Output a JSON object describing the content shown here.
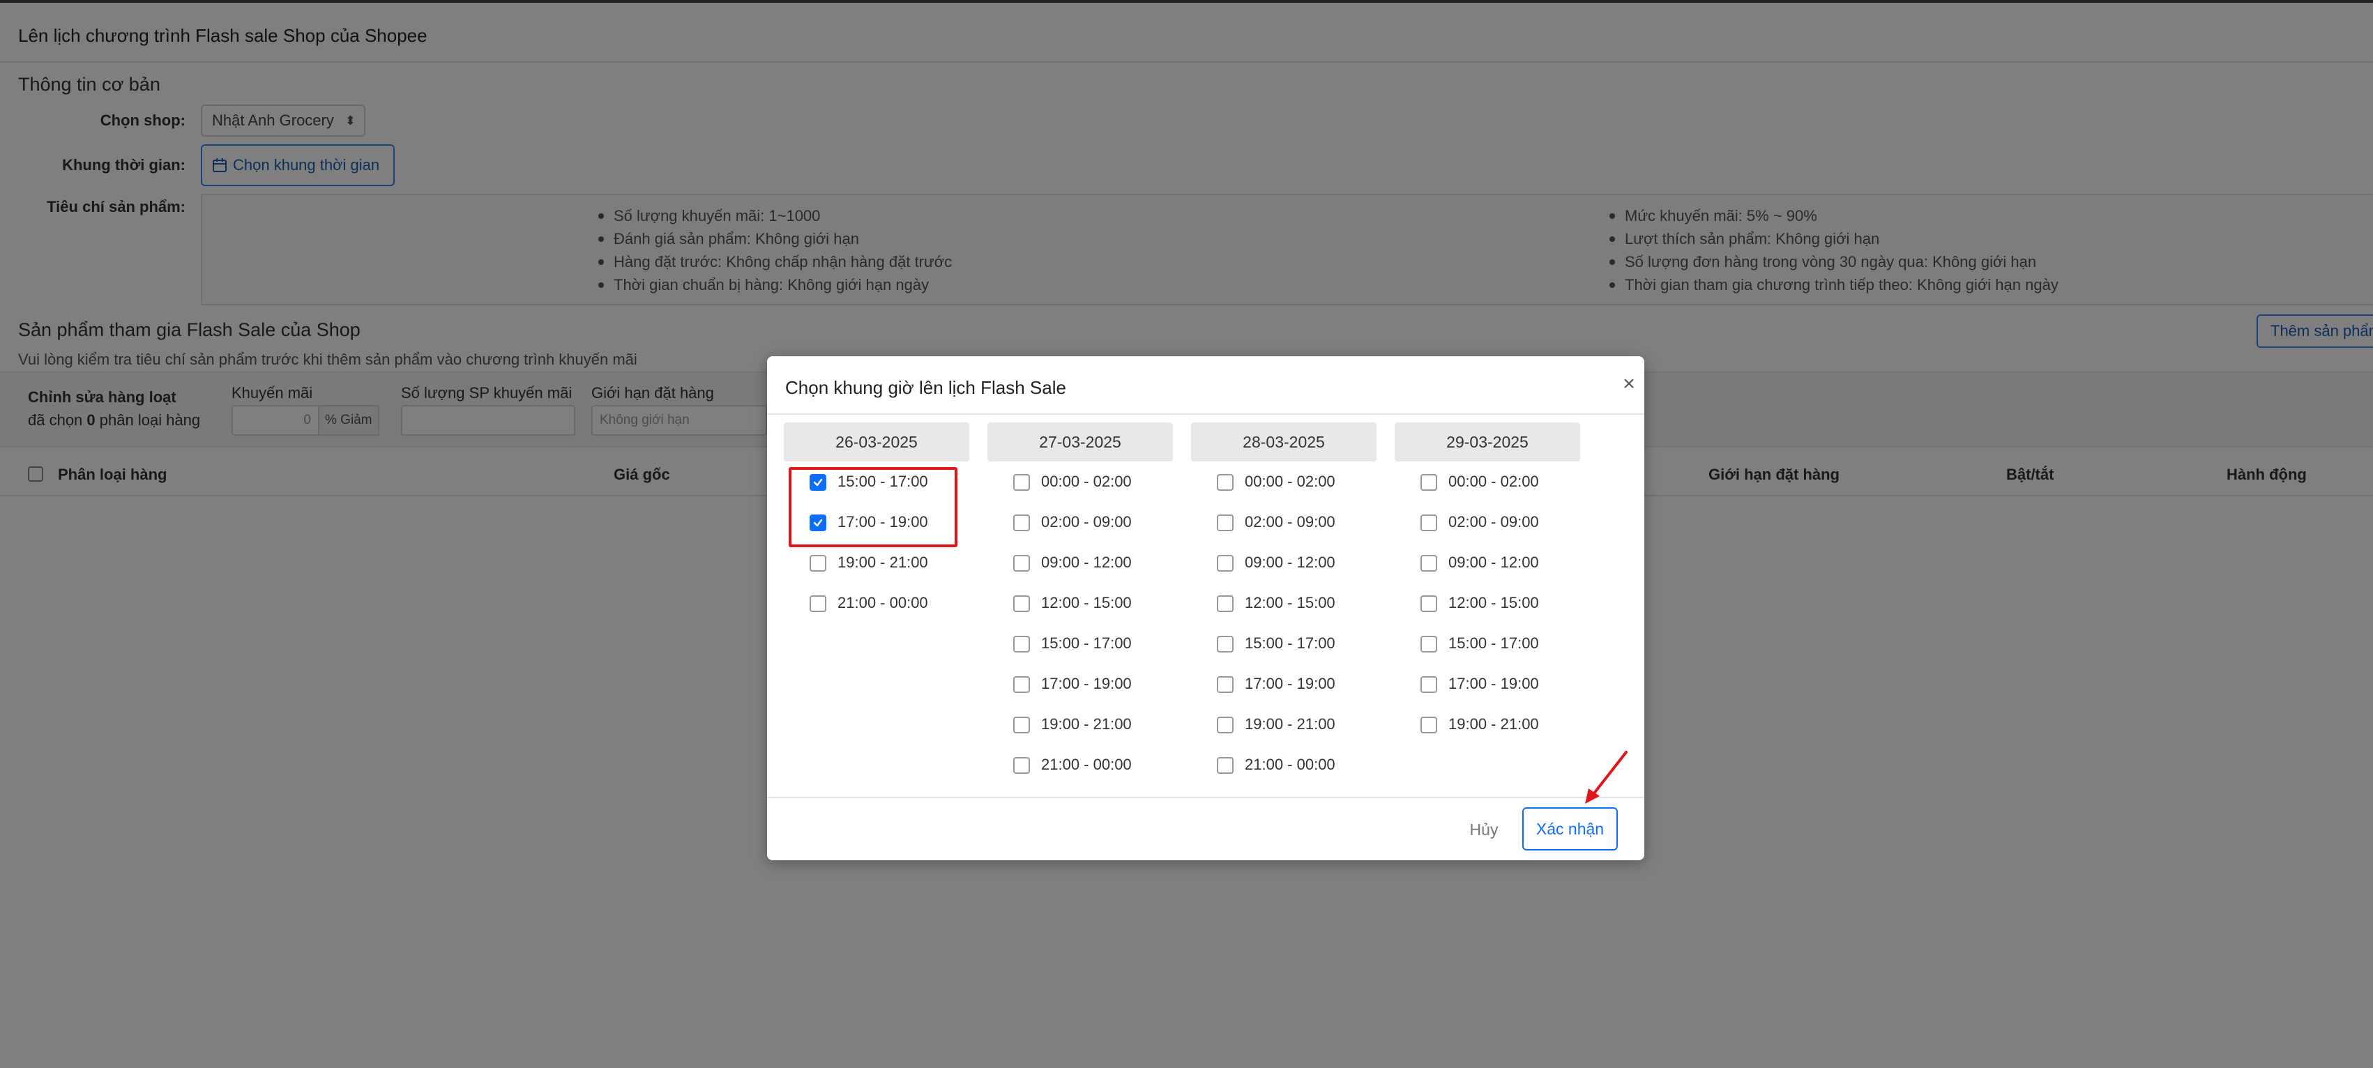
{
  "page": {
    "title": "Lên lịch chương trình Flash sale Shop của Shopee"
  },
  "basic_info": {
    "section_title": "Thông tin cơ bản",
    "shop_label": "Chọn shop:",
    "shop_value": "Nhật Anh Grocery",
    "time_label": "Khung thời gian:",
    "time_button": "Chọn khung thời gian",
    "criteria_label": "Tiêu chí sản phẩm:",
    "criteria_left": [
      "Số lượng khuyến mãi: 1~1000",
      "Đánh giá sản phẩm: Không giới hạn",
      "Hàng đặt trước: Không chấp nhận hàng đặt trước",
      "Thời gian chuẩn bị hàng: Không giới hạn ngày"
    ],
    "criteria_right": [
      "Mức khuyến mãi: 5% ~ 90%",
      "Lượt thích sản phẩm: Không giới hạn",
      "Số lượng đơn hàng trong vòng 30 ngày qua: Không giới hạn",
      "Thời gian tham gia chương trình tiếp theo: Không giới hạn ngày"
    ]
  },
  "products": {
    "section_title": "Sản phẩm tham gia Flash Sale của Shop",
    "note": "Vui lòng kiểm tra tiêu chí sản phẩm trước khi thêm sản phẩm vào chương trình khuyến mãi",
    "add_button": "Thêm sản phẩm",
    "bulk": {
      "title": "Chỉnh sửa hàng loạt",
      "selected_prefix": "đã chọn",
      "selected_count": "0",
      "selected_suffix": "phân loại hàng",
      "promo_label": "Khuyến mãi",
      "promo_value": "0",
      "promo_unit": "% Giảm",
      "qty_label": "Số lượng SP khuyến mãi",
      "limit_label": "Giới hạn đặt hàng",
      "limit_placeholder": "Không giới hạn"
    },
    "table_headers": {
      "variant": "Phân loại hàng",
      "price": "Giá gốc",
      "order_limit": "Giới hạn đặt hàng",
      "toggle": "Bật/tắt",
      "action": "Hành động"
    }
  },
  "modal": {
    "title": "Chọn khung giờ lên lịch Flash Sale",
    "close_icon": "close-icon",
    "days": [
      {
        "date": "26-03-2025",
        "slots": [
          {
            "label": "15:00 - 17:00",
            "checked": true
          },
          {
            "label": "17:00 - 19:00",
            "checked": true
          },
          {
            "label": "19:00 - 21:00",
            "checked": false
          },
          {
            "label": "21:00 - 00:00",
            "checked": false
          }
        ]
      },
      {
        "date": "27-03-2025",
        "slots": [
          {
            "label": "00:00 - 02:00",
            "checked": false
          },
          {
            "label": "02:00 - 09:00",
            "checked": false
          },
          {
            "label": "09:00 - 12:00",
            "checked": false
          },
          {
            "label": "12:00 - 15:00",
            "checked": false
          },
          {
            "label": "15:00 - 17:00",
            "checked": false
          },
          {
            "label": "17:00 - 19:00",
            "checked": false
          },
          {
            "label": "19:00 - 21:00",
            "checked": false
          },
          {
            "label": "21:00 - 00:00",
            "checked": false
          }
        ]
      },
      {
        "date": "28-03-2025",
        "slots": [
          {
            "label": "00:00 - 02:00",
            "checked": false
          },
          {
            "label": "02:00 - 09:00",
            "checked": false
          },
          {
            "label": "09:00 - 12:00",
            "checked": false
          },
          {
            "label": "12:00 - 15:00",
            "checked": false
          },
          {
            "label": "15:00 - 17:00",
            "checked": false
          },
          {
            "label": "17:00 - 19:00",
            "checked": false
          },
          {
            "label": "19:00 - 21:00",
            "checked": false
          },
          {
            "label": "21:00 - 00:00",
            "checked": false
          }
        ]
      },
      {
        "date": "29-03-2025",
        "slots": [
          {
            "label": "00:00 - 02:00",
            "checked": false
          },
          {
            "label": "02:00 - 09:00",
            "checked": false
          },
          {
            "label": "09:00 - 12:00",
            "checked": false
          },
          {
            "label": "12:00 - 15:00",
            "checked": false
          },
          {
            "label": "15:00 - 17:00",
            "checked": false
          },
          {
            "label": "17:00 - 19:00",
            "checked": false
          },
          {
            "label": "19:00 - 21:00",
            "checked": false
          }
        ]
      }
    ],
    "cancel_label": "Hủy",
    "confirm_label": "Xác nhận"
  },
  "colors": {
    "accent": "#0d6efd",
    "annotation": "#e0161b",
    "overlay": "rgba(0,0,0,0.5)"
  }
}
